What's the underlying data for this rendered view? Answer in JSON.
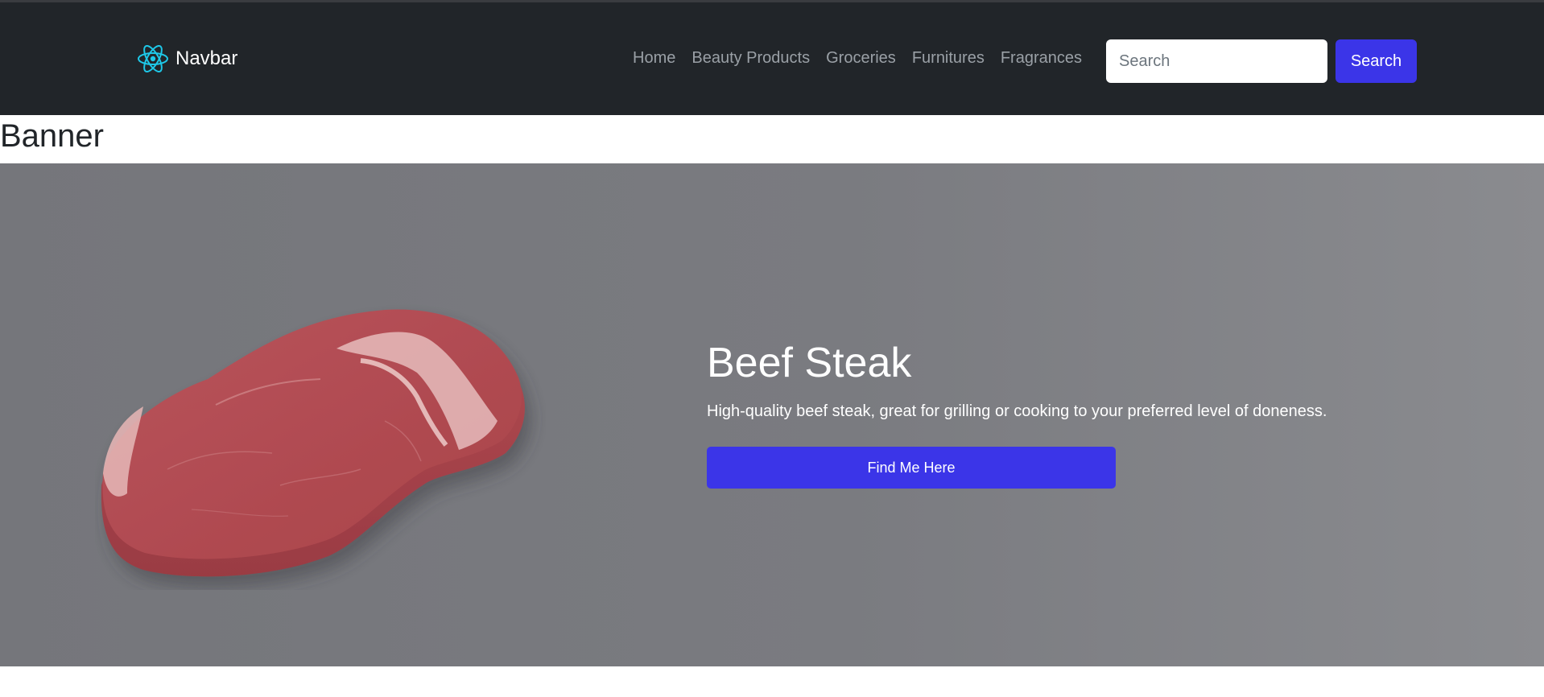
{
  "navbar": {
    "brand_icon": "react-atom-icon",
    "brand_label": "Navbar",
    "links": [
      "Home",
      "Beauty Products",
      "Groceries",
      "Furnitures",
      "Fragrances"
    ],
    "search": {
      "placeholder": "Search",
      "value": "",
      "button_label": "Search"
    }
  },
  "page": {
    "heading": "Banner"
  },
  "banner": {
    "image_icon": "beef-steak-image",
    "title": "Beef Steak",
    "description": "High-quality beef steak, great for grilling or cooking to your preferred level of doneness.",
    "cta_label": "Find Me Here"
  },
  "colors": {
    "navbar_bg": "#212529",
    "accent": "#3b35e8",
    "hero_bg": "#7a7b80",
    "nav_link": "#9aa0a6",
    "logo": "#1ec8e8"
  }
}
